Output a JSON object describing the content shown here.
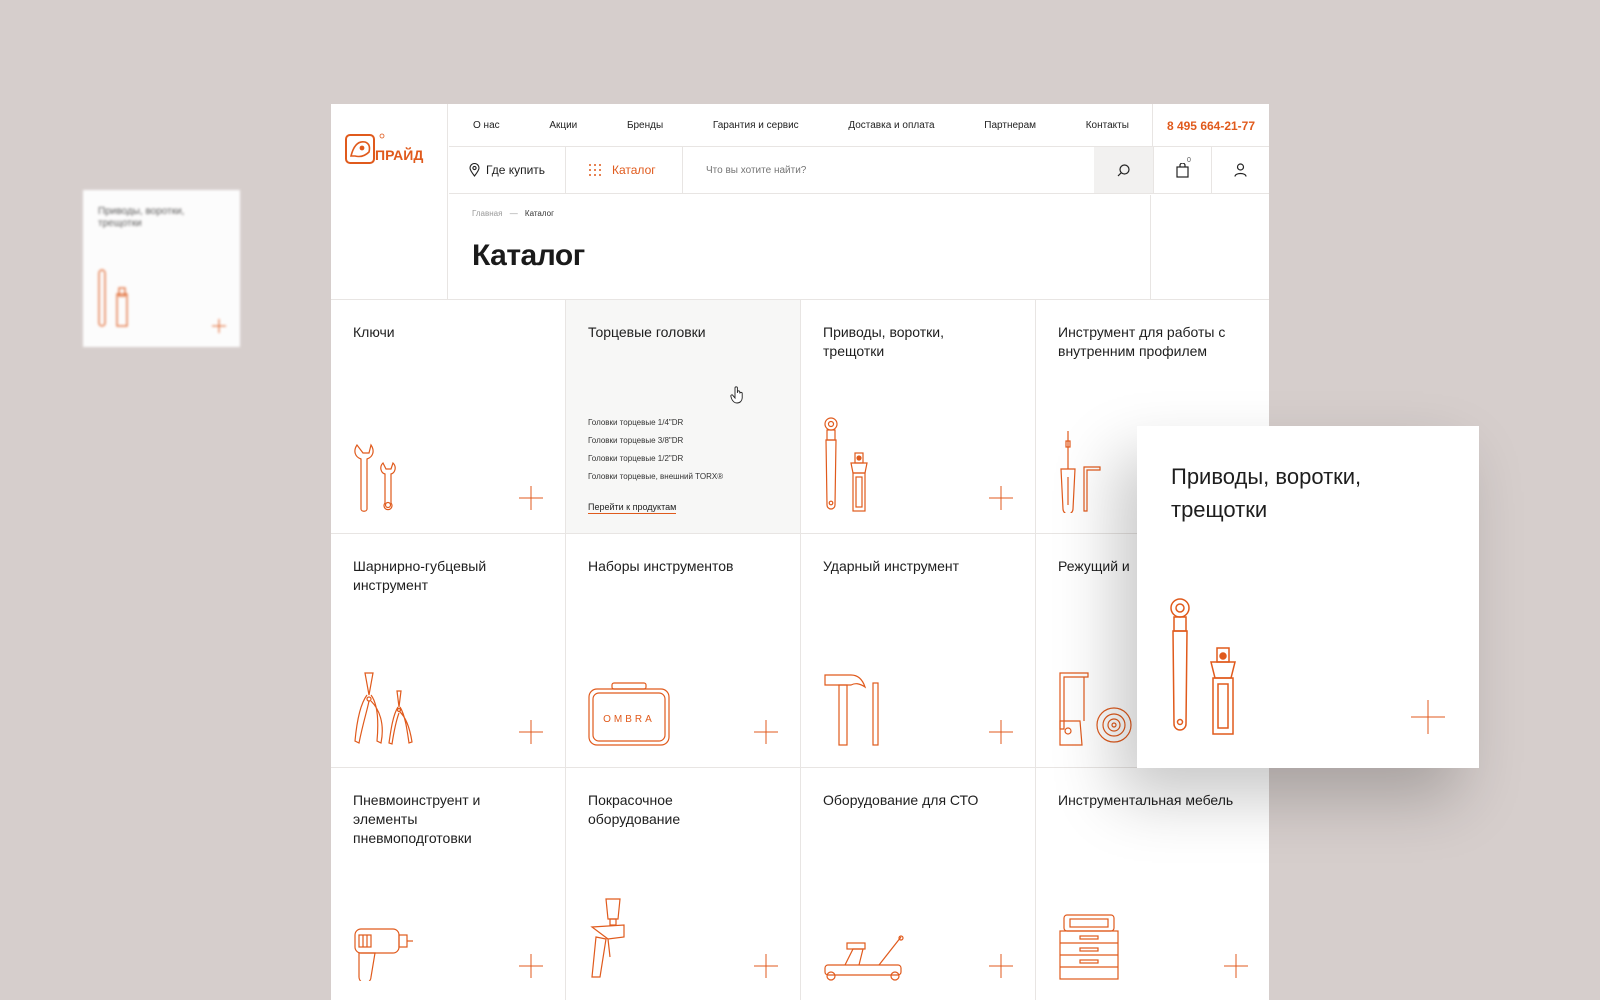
{
  "ghost_card": {
    "label": "Приводы, воротки, трещотки"
  },
  "brand": {
    "accent": "#e05a1c",
    "logo_text": "ПРАЙД"
  },
  "nav": {
    "items": [
      "О нас",
      "Акции",
      "Бренды",
      "Гарантия и сервис",
      "Доставка и оплата",
      "Партнерам",
      "Контакты"
    ],
    "phone": "8 495 664-21-77"
  },
  "toolbar": {
    "where_label": "Где купить",
    "catalog_label": "Каталог",
    "search_placeholder": "Что вы хотите найти?",
    "cart_count": "0"
  },
  "breadcrumb": {
    "home": "Главная",
    "sep": "—",
    "current": "Каталог"
  },
  "page_title": "Каталог",
  "categories": [
    {
      "label": "Ключи",
      "icon": "wrench-icon"
    },
    {
      "label": "Торцевые головки",
      "icon": "socket-icon",
      "sublist": [
        "Головки торцевые 1/4\"DR",
        "Головки торцевые 3/8\"DR",
        "Головки торцевые 1/2\"DR",
        "Головки торцевые, внешний TORX®"
      ],
      "link": "Перейти к продуктам"
    },
    {
      "label": "Приводы, воротки, трещотки",
      "icon": "ratchet-icon"
    },
    {
      "label": "Инструмент для работы с внутренним профилем",
      "icon": "screwdriver-icon"
    },
    {
      "label": "Шарнирно-губцевый инструмент",
      "icon": "pliers-icon"
    },
    {
      "label": "Наборы инструментов",
      "icon": "toolcase-icon",
      "case_text": "OMBRA"
    },
    {
      "label": "Ударный инструмент",
      "icon": "hammer-icon"
    },
    {
      "label": "Режущий и",
      "icon": "saw-icon"
    },
    {
      "label": "Пневмоинструент и элементы пневмоподготовки",
      "icon": "pneumatic-drill-icon"
    },
    {
      "label": "Покрасочное оборудование",
      "icon": "spray-gun-icon"
    },
    {
      "label": "Оборудование для СТО",
      "icon": "jack-icon"
    },
    {
      "label": "Инструментальная мебель",
      "icon": "tool-cabinet-icon"
    }
  ],
  "popup": {
    "label": "Приводы, воротки, трещотки"
  }
}
